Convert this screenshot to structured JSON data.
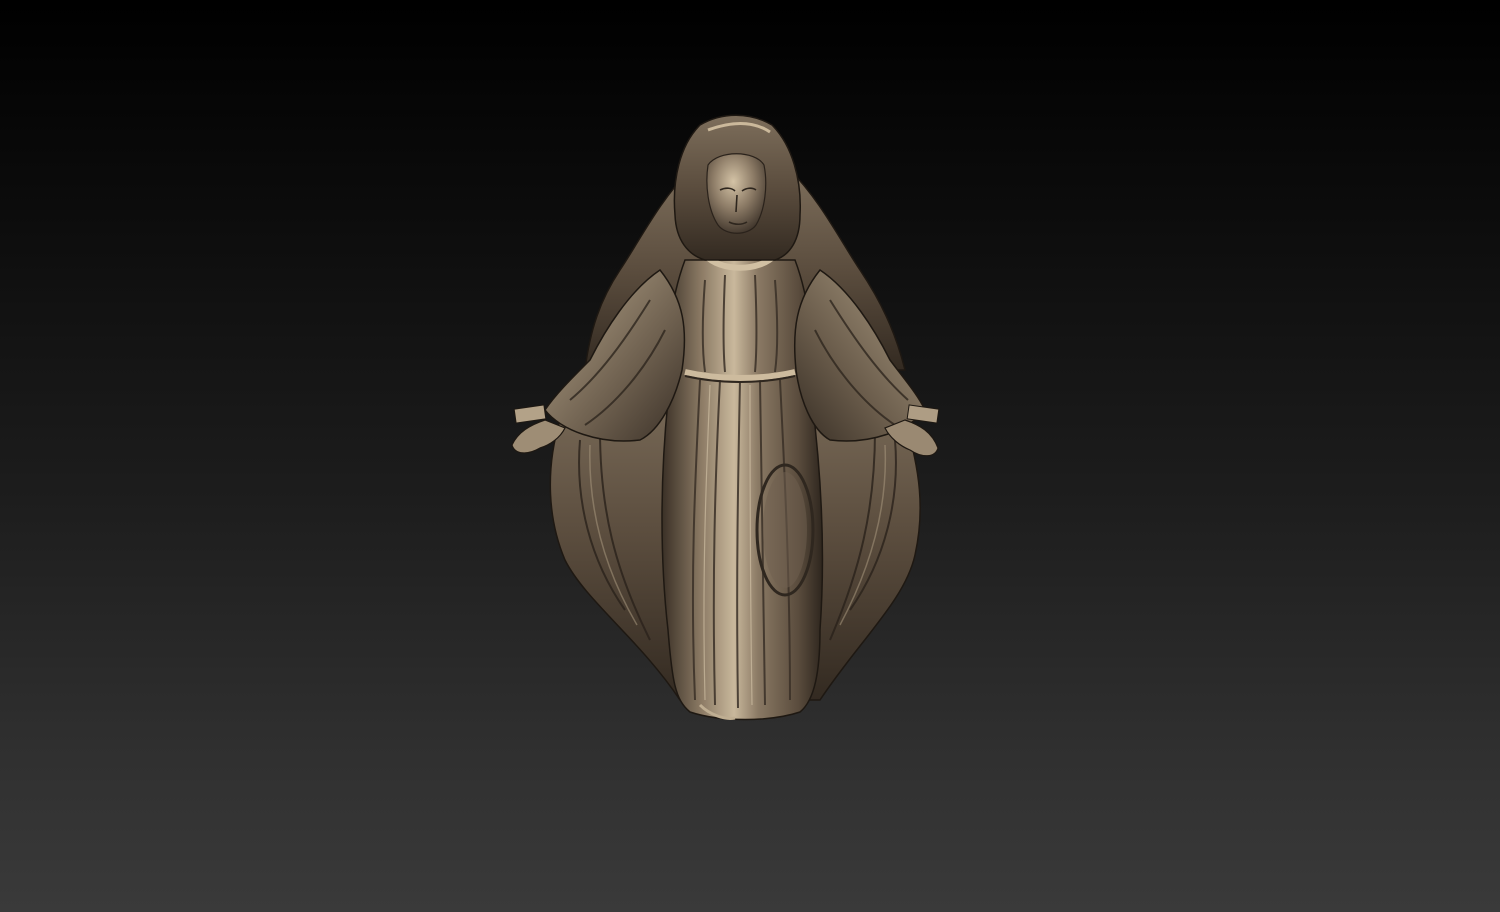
{
  "scene": {
    "subject_icon": "madonna-relief-sculpture",
    "colors": {
      "background_top": "#000000",
      "background_bottom": "#3a3a3a",
      "metal_highlight": "#d9cbb4",
      "metal_mid": "#8b7b66",
      "metal_shadow": "#2a231c"
    }
  }
}
